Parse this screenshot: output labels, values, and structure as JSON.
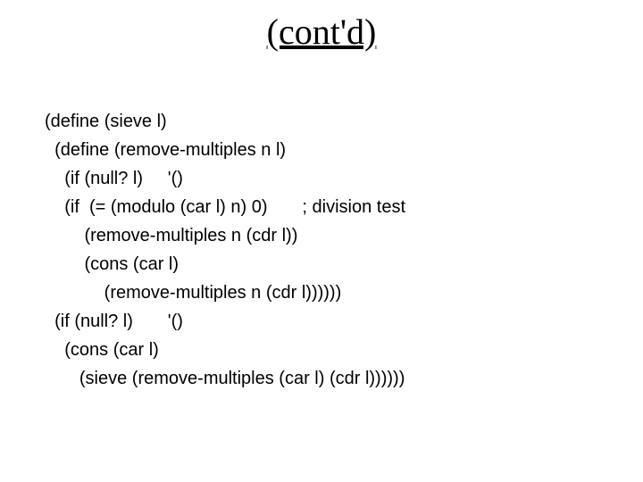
{
  "title": "(cont'd)",
  "lines": {
    "l1": "(define (sieve l)",
    "l2": "  (define (remove-multiples n l)",
    "l3": "    (if (null? l)     '()",
    "l4": "    (if  (= (modulo (car l) n) 0)       ; division test",
    "l5": "        (remove-multiples n (cdr l))",
    "l6": "        (cons (car l)",
    "l7": "            (remove-multiples n (cdr l))))))",
    "l8": "  (if (null? l)       '()",
    "l9": "    (cons (car l)",
    "l10": "       (sieve (remove-multiples (car l) (cdr l))))))"
  }
}
